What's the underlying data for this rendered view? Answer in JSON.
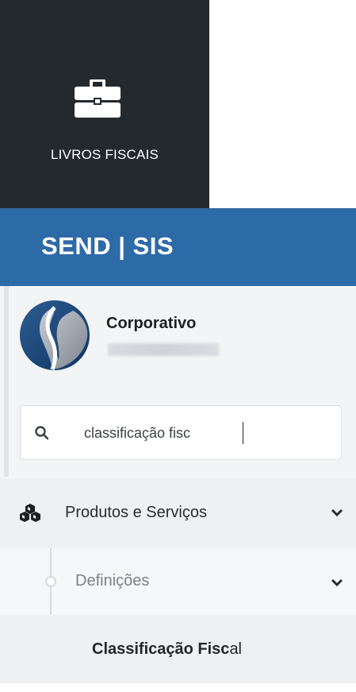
{
  "app_tile": {
    "label": "LIVROS FISCAIS",
    "icon": "briefcase-icon"
  },
  "brand": {
    "title": "SEND | SIS",
    "background": "#2d6aa8"
  },
  "user": {
    "name": "Corporativo"
  },
  "search": {
    "value": "classificação fisc",
    "icon": "search-icon"
  },
  "menu": {
    "products": {
      "label": "Produtos e Serviços",
      "icon": "cubes-icon"
    },
    "definitions": {
      "label": "Definições"
    },
    "classification": {
      "label_match": "Classificação Fisc",
      "label_rest": "al"
    }
  }
}
